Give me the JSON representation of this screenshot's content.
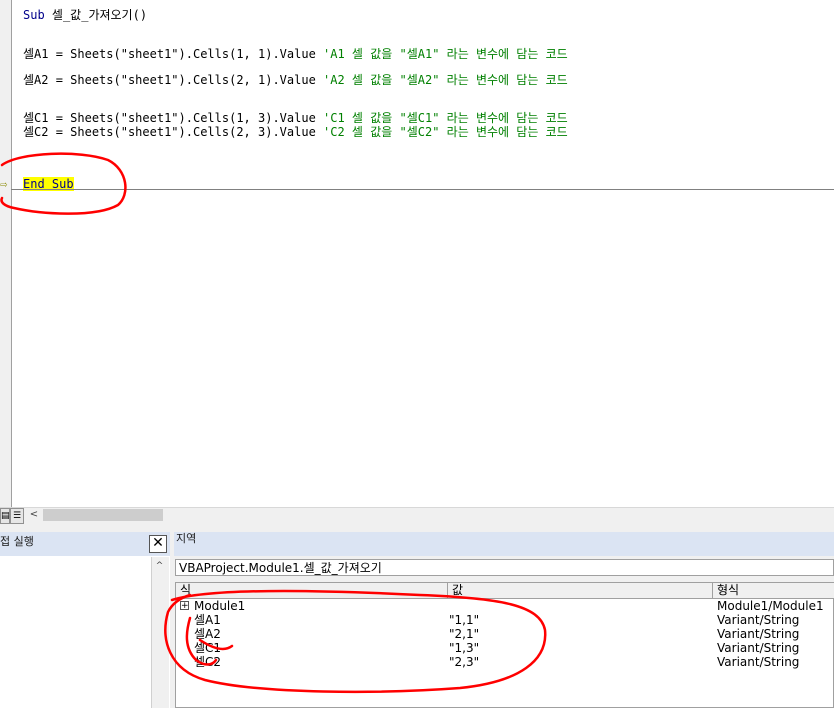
{
  "code": {
    "line1": {
      "kw": "Sub",
      "rest": " 셀_값_가져오기()"
    },
    "line2": {
      "code": "셀A1 = Sheets(\"sheet1\").Cells(1, 1).Value ",
      "comment": "'A1 셀 값을 \"셀A1\" 라는 변수에 담는 코드"
    },
    "line3": {
      "code": "셀A2 = Sheets(\"sheet1\").Cells(2, 1).Value ",
      "comment": "'A2 셀 값을 \"셀A2\" 라는 변수에 담는 코드"
    },
    "line4": {
      "code": "셀C1 = Sheets(\"sheet1\").Cells(1, 3).Value ",
      "comment": "'C1 셀 값을 \"셀C1\" 라는 변수에 담는 코드"
    },
    "line5": {
      "code": "셀C2 = Sheets(\"sheet1\").Cells(2, 3).Value ",
      "comment": "'C2 셀 값을 \"셀C2\" 라는 변수에 담는 코드"
    },
    "end_sub": "End Sub",
    "exec_arrow": "⇨"
  },
  "scroll": {
    "left_arrow": "<",
    "up_arrow": "^"
  },
  "immediate": {
    "title": "접 실행",
    "close": "✕"
  },
  "locals": {
    "title": "지역",
    "context": "VBAProject.Module1.셀_값_가져오기",
    "headers": [
      "식",
      "값",
      "형식"
    ],
    "rows": [
      {
        "expand": "+",
        "name": "Module1",
        "value": "",
        "type": "Module1/Module1"
      },
      {
        "name": "셀A1",
        "value": "\"1,1\"",
        "type": "Variant/String"
      },
      {
        "name": "셀A2",
        "value": "\"2,1\"",
        "type": "Variant/String"
      },
      {
        "name": "셀C1",
        "value": "\"1,3\"",
        "type": "Variant/String"
      },
      {
        "name": "셀C2",
        "value": "\"2,3\"",
        "type": "Variant/String"
      }
    ]
  },
  "colors": {
    "keyword": "#00008b",
    "comment": "#008000",
    "highlight": "#ffff00",
    "annotation": "#ff0000"
  }
}
